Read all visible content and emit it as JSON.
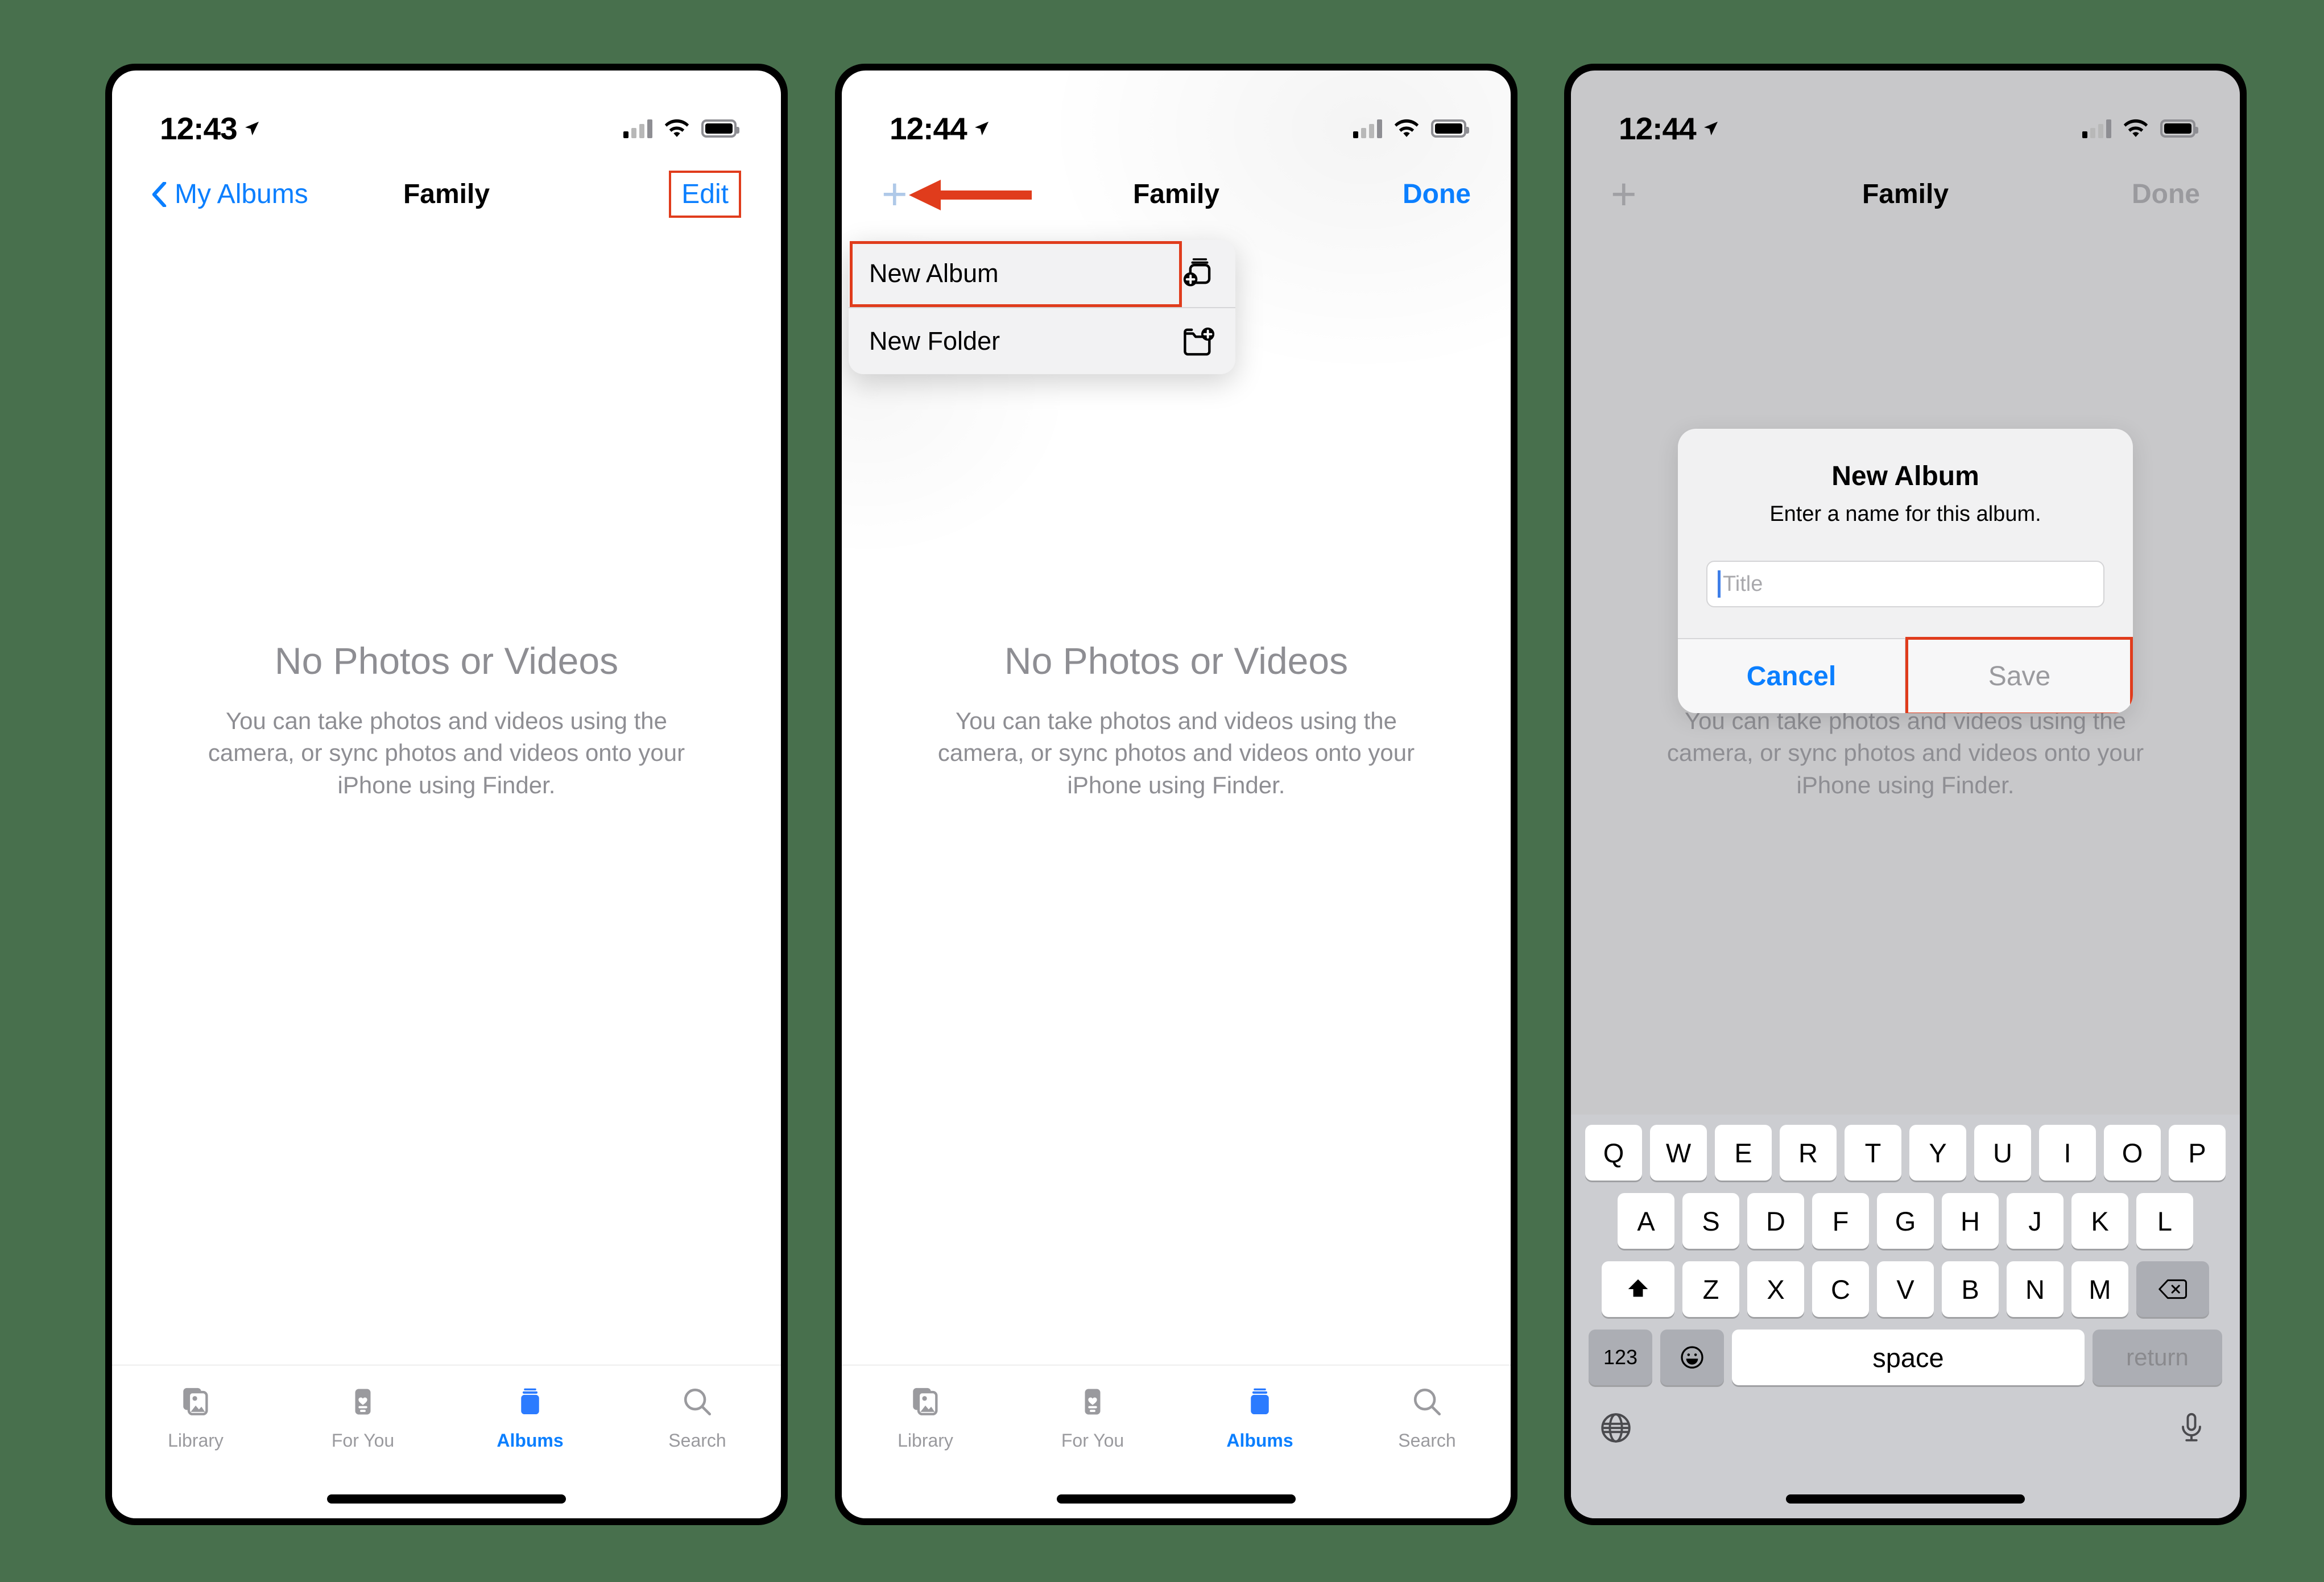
{
  "background_color": "#48704D",
  "accent_blue": "#0B7FFF",
  "highlight_red": "#E03C1C",
  "phones": [
    {
      "id": "phone-1",
      "status": {
        "time": "12:43",
        "location_icon": "location-arrow-icon",
        "signal_icon": "cellular-bars-icon",
        "wifi_icon": "wifi-icon",
        "battery_icon": "battery-full-icon"
      },
      "nav": {
        "back_label": "My Albums",
        "title": "Family",
        "action_label": "Edit"
      },
      "empty_state": {
        "title": "No Photos or Videos",
        "body": "You can take photos and videos using the camera, or sync photos and videos onto your iPhone using Finder."
      },
      "tabs": [
        {
          "label": "Library",
          "icon": "photo-stack-icon",
          "active": false
        },
        {
          "label": "For You",
          "icon": "heart-card-icon",
          "active": false
        },
        {
          "label": "Albums",
          "icon": "albums-icon",
          "active": true
        },
        {
          "label": "Search",
          "icon": "magnifier-icon",
          "active": false
        }
      ]
    },
    {
      "id": "phone-2",
      "status": {
        "time": "12:44",
        "location_icon": "location-arrow-icon",
        "signal_icon": "cellular-bars-icon",
        "wifi_icon": "wifi-icon",
        "battery_icon": "battery-full-icon"
      },
      "nav": {
        "add_icon": "plus-icon",
        "title": "Family",
        "action_label": "Done"
      },
      "popup_menu": [
        {
          "label": "New Album",
          "icon": "new-album-icon",
          "highlighted": true
        },
        {
          "label": "New Folder",
          "icon": "new-folder-icon",
          "highlighted": false
        }
      ],
      "annotation": {
        "arrow_icon": "left-arrow-annotation",
        "points_to": "plus-icon"
      },
      "empty_state": {
        "title": "No Photos or Videos",
        "body": "You can take photos and videos using the camera, or sync photos and videos onto your iPhone using Finder."
      },
      "tabs": [
        {
          "label": "Library",
          "icon": "photo-stack-icon",
          "active": false
        },
        {
          "label": "For You",
          "icon": "heart-card-icon",
          "active": false
        },
        {
          "label": "Albums",
          "icon": "albums-icon",
          "active": true
        },
        {
          "label": "Search",
          "icon": "magnifier-icon",
          "active": false
        }
      ]
    },
    {
      "id": "phone-3",
      "status": {
        "time": "12:44",
        "location_icon": "location-arrow-icon",
        "signal_icon": "cellular-bars-icon",
        "wifi_icon": "wifi-icon",
        "battery_icon": "battery-full-icon"
      },
      "nav": {
        "add_icon": "plus-icon",
        "title": "Family",
        "action_label": "Done"
      },
      "empty_state": {
        "title": "No Photos or Videos",
        "body": "You can take photos and videos using the camera, or sync photos and videos onto your iPhone using Finder."
      },
      "alert": {
        "title": "New Album",
        "message": "Enter a name for this album.",
        "input_value": "",
        "input_placeholder": "Title",
        "cancel_label": "Cancel",
        "save_label": "Save",
        "save_disabled": true,
        "save_highlighted": true
      },
      "keyboard": {
        "row1": [
          "Q",
          "W",
          "E",
          "R",
          "T",
          "Y",
          "U",
          "I",
          "O",
          "P"
        ],
        "row2": [
          "A",
          "S",
          "D",
          "F",
          "G",
          "H",
          "J",
          "K",
          "L"
        ],
        "row3_shift_icon": "shift-up-arrow-icon",
        "row3": [
          "Z",
          "X",
          "C",
          "V",
          "B",
          "N",
          "M"
        ],
        "row3_delete_icon": "delete-backspace-icon",
        "numbers_label": "123",
        "emoji_icon": "emoji-smiley-icon",
        "space_label": "space",
        "return_label": "return",
        "globe_icon": "globe-language-icon",
        "mic_icon": "microphone-icon"
      }
    }
  ]
}
